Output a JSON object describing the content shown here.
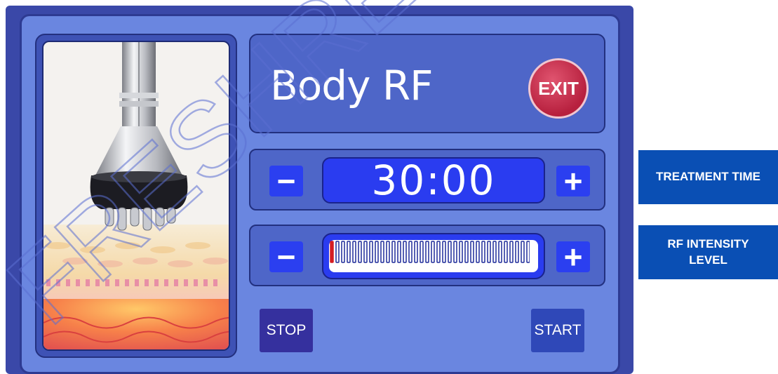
{
  "title": "Body RF",
  "exit_label": "EXIT",
  "treatment_time": {
    "value": "30:00",
    "minus_label": "−",
    "plus_label": "+",
    "tag": "TREATMENT TIME"
  },
  "rf_intensity": {
    "level_fraction": 0.04,
    "minus_label": "−",
    "plus_label": "+",
    "tag": "RF INTENSITY LEVEL"
  },
  "stop_label": "STOP",
  "start_label": "START",
  "watermark": "FRESHRE",
  "colors": {
    "frame": "#3a48a8",
    "screen": "#6a86e0",
    "accent_button": "#2b3ff0",
    "exit": "#b7203e",
    "intensity_active": "#d41d22",
    "tag_bg": "#0a4fb4"
  },
  "icons": {
    "device": "rf-handpiece-illustration",
    "skin": "skin-layers-illustration"
  }
}
